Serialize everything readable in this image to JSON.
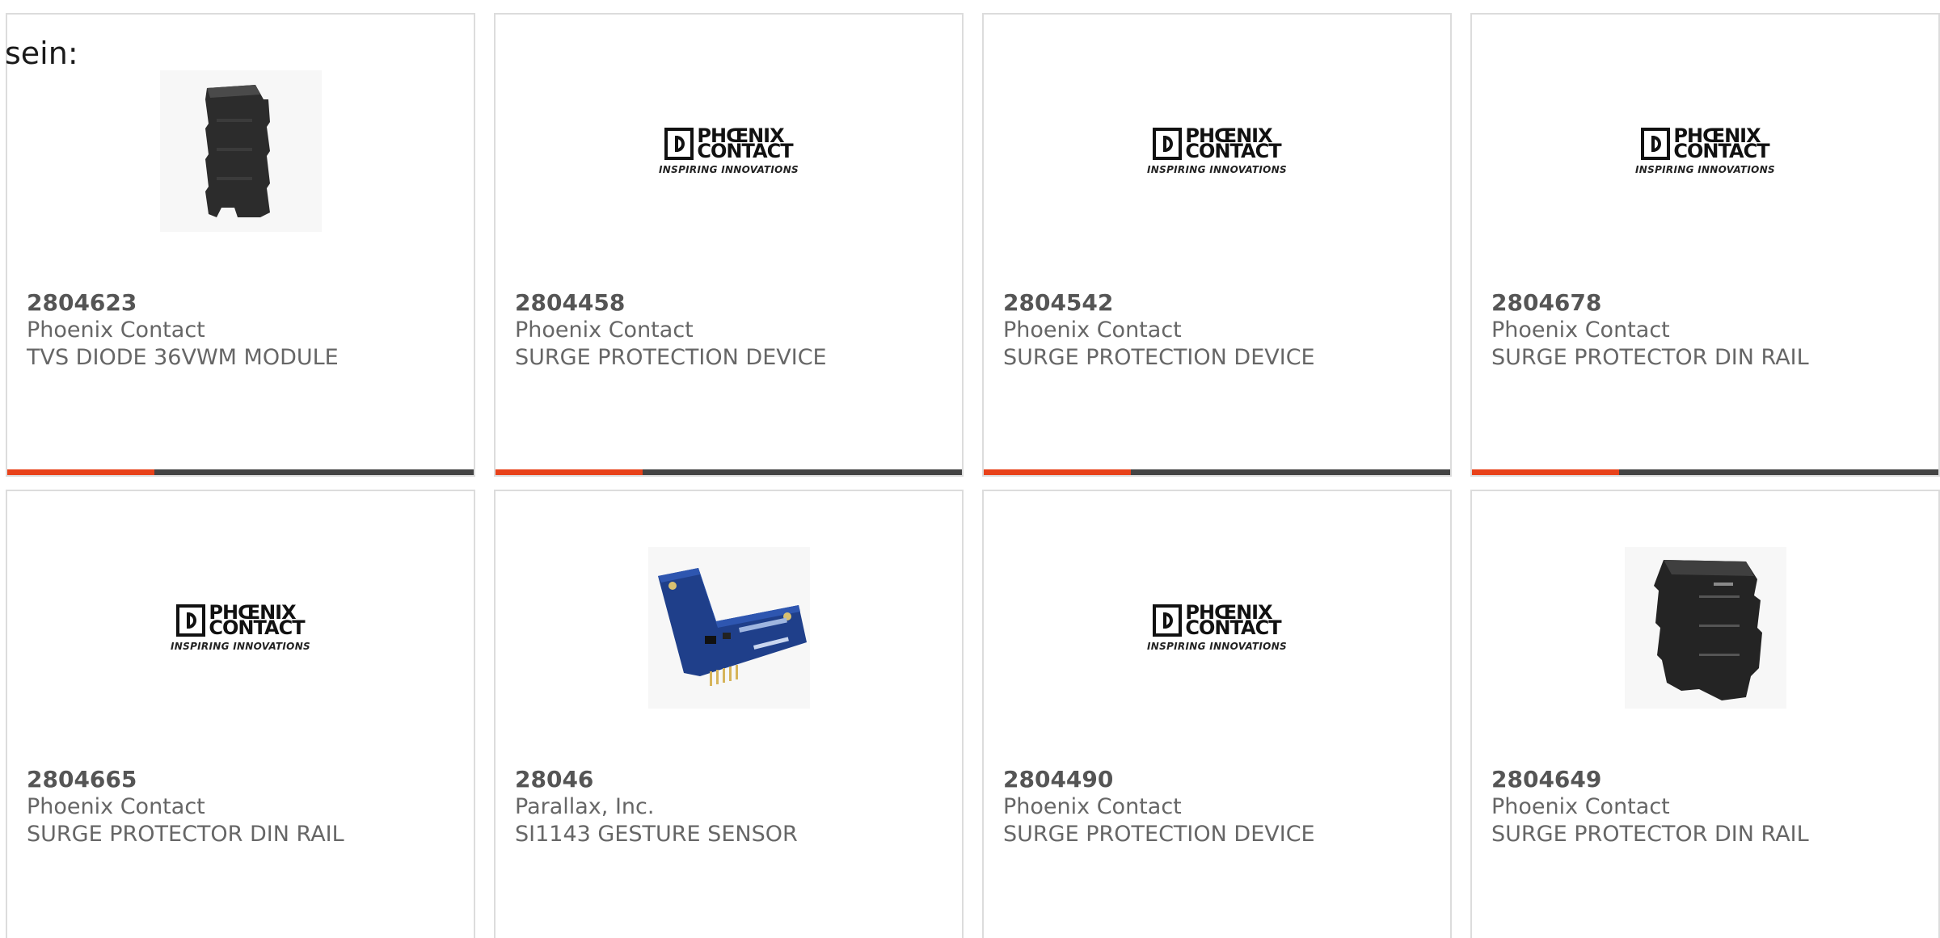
{
  "intro_text": "sein:",
  "logo": {
    "line1": "PHŒNIX",
    "line2": "CONTACT",
    "tagline": "INSPIRING INNOVATIONS"
  },
  "products": [
    {
      "part": "2804623",
      "manufacturer": "Phoenix Contact",
      "description": "TVS DIODE 36VWM MODULE",
      "image": "din-module-photo"
    },
    {
      "part": "2804458",
      "manufacturer": "Phoenix Contact",
      "description": "SURGE PROTECTION DEVICE",
      "image": "phoenix-logo"
    },
    {
      "part": "2804542",
      "manufacturer": "Phoenix Contact",
      "description": "SURGE PROTECTION DEVICE",
      "image": "phoenix-logo"
    },
    {
      "part": "2804678",
      "manufacturer": "Phoenix Contact",
      "description": "SURGE PROTECTOR DIN RAIL",
      "image": "phoenix-logo"
    },
    {
      "part": "2804665",
      "manufacturer": "Phoenix Contact",
      "description": "SURGE PROTECTOR DIN RAIL",
      "image": "phoenix-logo"
    },
    {
      "part": "28046",
      "manufacturer": "Parallax, Inc.",
      "description": "SI1143 GESTURE SENSOR",
      "image": "gesture-sensor-photo"
    },
    {
      "part": "2804490",
      "manufacturer": "Phoenix Contact",
      "description": "SURGE PROTECTION DEVICE",
      "image": "phoenix-logo"
    },
    {
      "part": "2804649",
      "manufacturer": "Phoenix Contact",
      "description": "SURGE PROTECTOR DIN RAIL",
      "image": "din-module-photo"
    }
  ],
  "colors": {
    "accent": "#e8421a",
    "bar": "#444444",
    "border": "#dcdcdc",
    "text": "#666666"
  }
}
